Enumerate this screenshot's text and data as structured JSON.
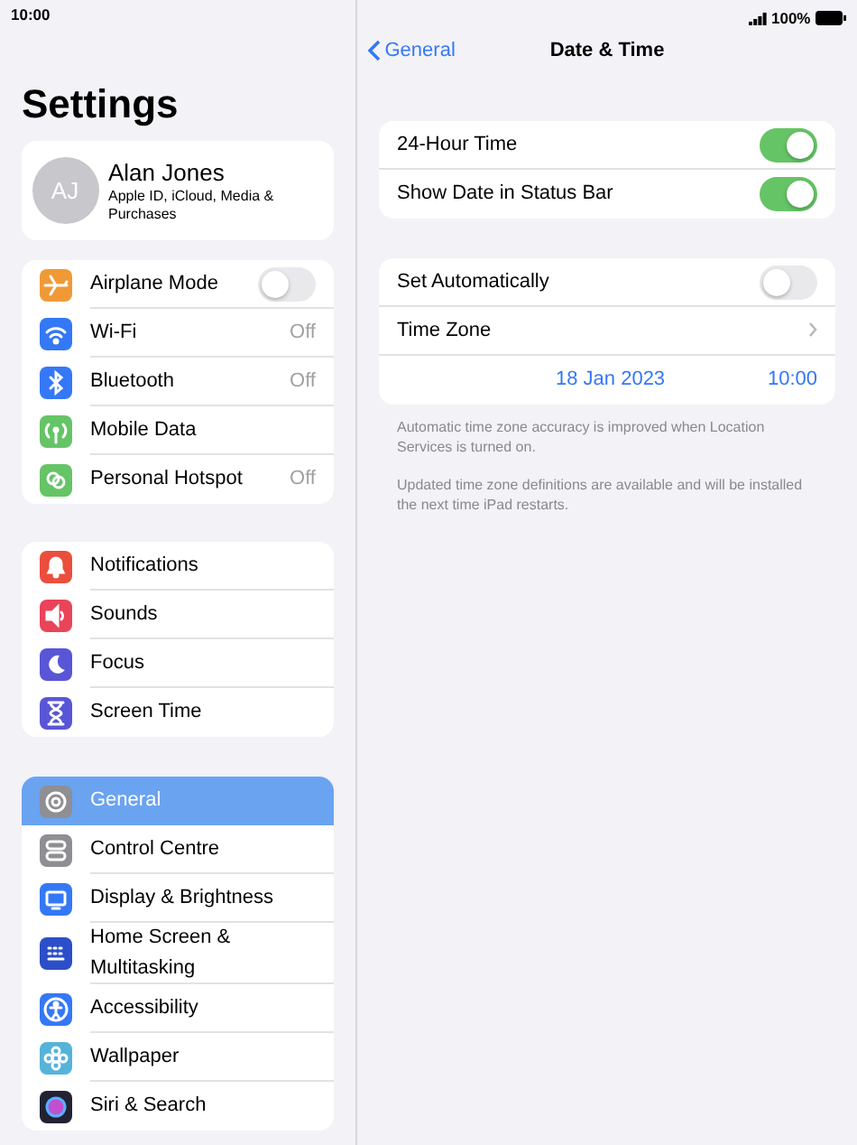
{
  "status_bar": {
    "time": "10:00",
    "battery": "100%"
  },
  "sidebar": {
    "title": "Settings",
    "profile": {
      "initials": "AJ",
      "name": "Alan Jones",
      "subtitle": "Apple ID, iCloud, Media & Purchases"
    },
    "groups": [
      [
        {
          "label": "Airplane Mode",
          "kind": "toggle",
          "on": false,
          "selected": false,
          "color": "#f09a37"
        },
        {
          "label": "Wi-Fi",
          "kind": "value",
          "value": "Off",
          "selected": false,
          "color": "#3478f6"
        },
        {
          "label": "Bluetooth",
          "kind": "value",
          "value": "Off",
          "selected": false,
          "color": "#3478f6"
        },
        {
          "label": "Mobile Data",
          "kind": "plain",
          "selected": false,
          "color": "#65c466"
        },
        {
          "label": "Personal Hotspot",
          "kind": "value",
          "value": "Off",
          "selected": false,
          "color": "#65c466"
        }
      ],
      [
        {
          "label": "Notifications",
          "kind": "plain",
          "selected": false,
          "color": "#eb4e3d"
        },
        {
          "label": "Sounds",
          "kind": "plain",
          "selected": false,
          "color": "#e9445a"
        },
        {
          "label": "Focus",
          "kind": "plain",
          "selected": false,
          "color": "#5856d6"
        },
        {
          "label": "Screen Time",
          "kind": "plain",
          "selected": false,
          "color": "#5856d6"
        }
      ],
      [
        {
          "label": "General",
          "kind": "plain",
          "selected": true,
          "color": "#8e8e93"
        },
        {
          "label": "Control Centre",
          "kind": "plain",
          "selected": false,
          "color": "#8e8e93"
        },
        {
          "label": "Display & Brightness",
          "kind": "plain",
          "selected": false,
          "color": "#3478f6"
        },
        {
          "label": "Home Screen & Multitasking",
          "kind": "plain",
          "selected": false,
          "color": "#2c4fc9"
        },
        {
          "label": "Accessibility",
          "kind": "plain",
          "selected": false,
          "color": "#3478f6"
        },
        {
          "label": "Wallpaper",
          "kind": "plain",
          "selected": false,
          "color": "#55b3d9"
        },
        {
          "label": "Siri & Search",
          "kind": "plain",
          "selected": false,
          "color": "#222233"
        }
      ]
    ]
  },
  "detail": {
    "back": "General",
    "title": "Date & Time",
    "groups": [
      [
        {
          "kind": "toggle",
          "label": "24-Hour Time",
          "on": true
        },
        {
          "kind": "toggle",
          "label": "Show Date in Status Bar",
          "on": true
        }
      ],
      [
        {
          "kind": "toggle",
          "label": "Set Automatically",
          "on": false
        },
        {
          "kind": "link",
          "label": "Time Zone"
        },
        {
          "kind": "datetime",
          "date": "18 Jan 2023",
          "time": "10:00"
        }
      ]
    ],
    "notes": [
      "Automatic time zone accuracy is improved when Location Services is turned on.",
      "Updated time zone definitions are available and will be installed the next time iPad restarts."
    ]
  }
}
